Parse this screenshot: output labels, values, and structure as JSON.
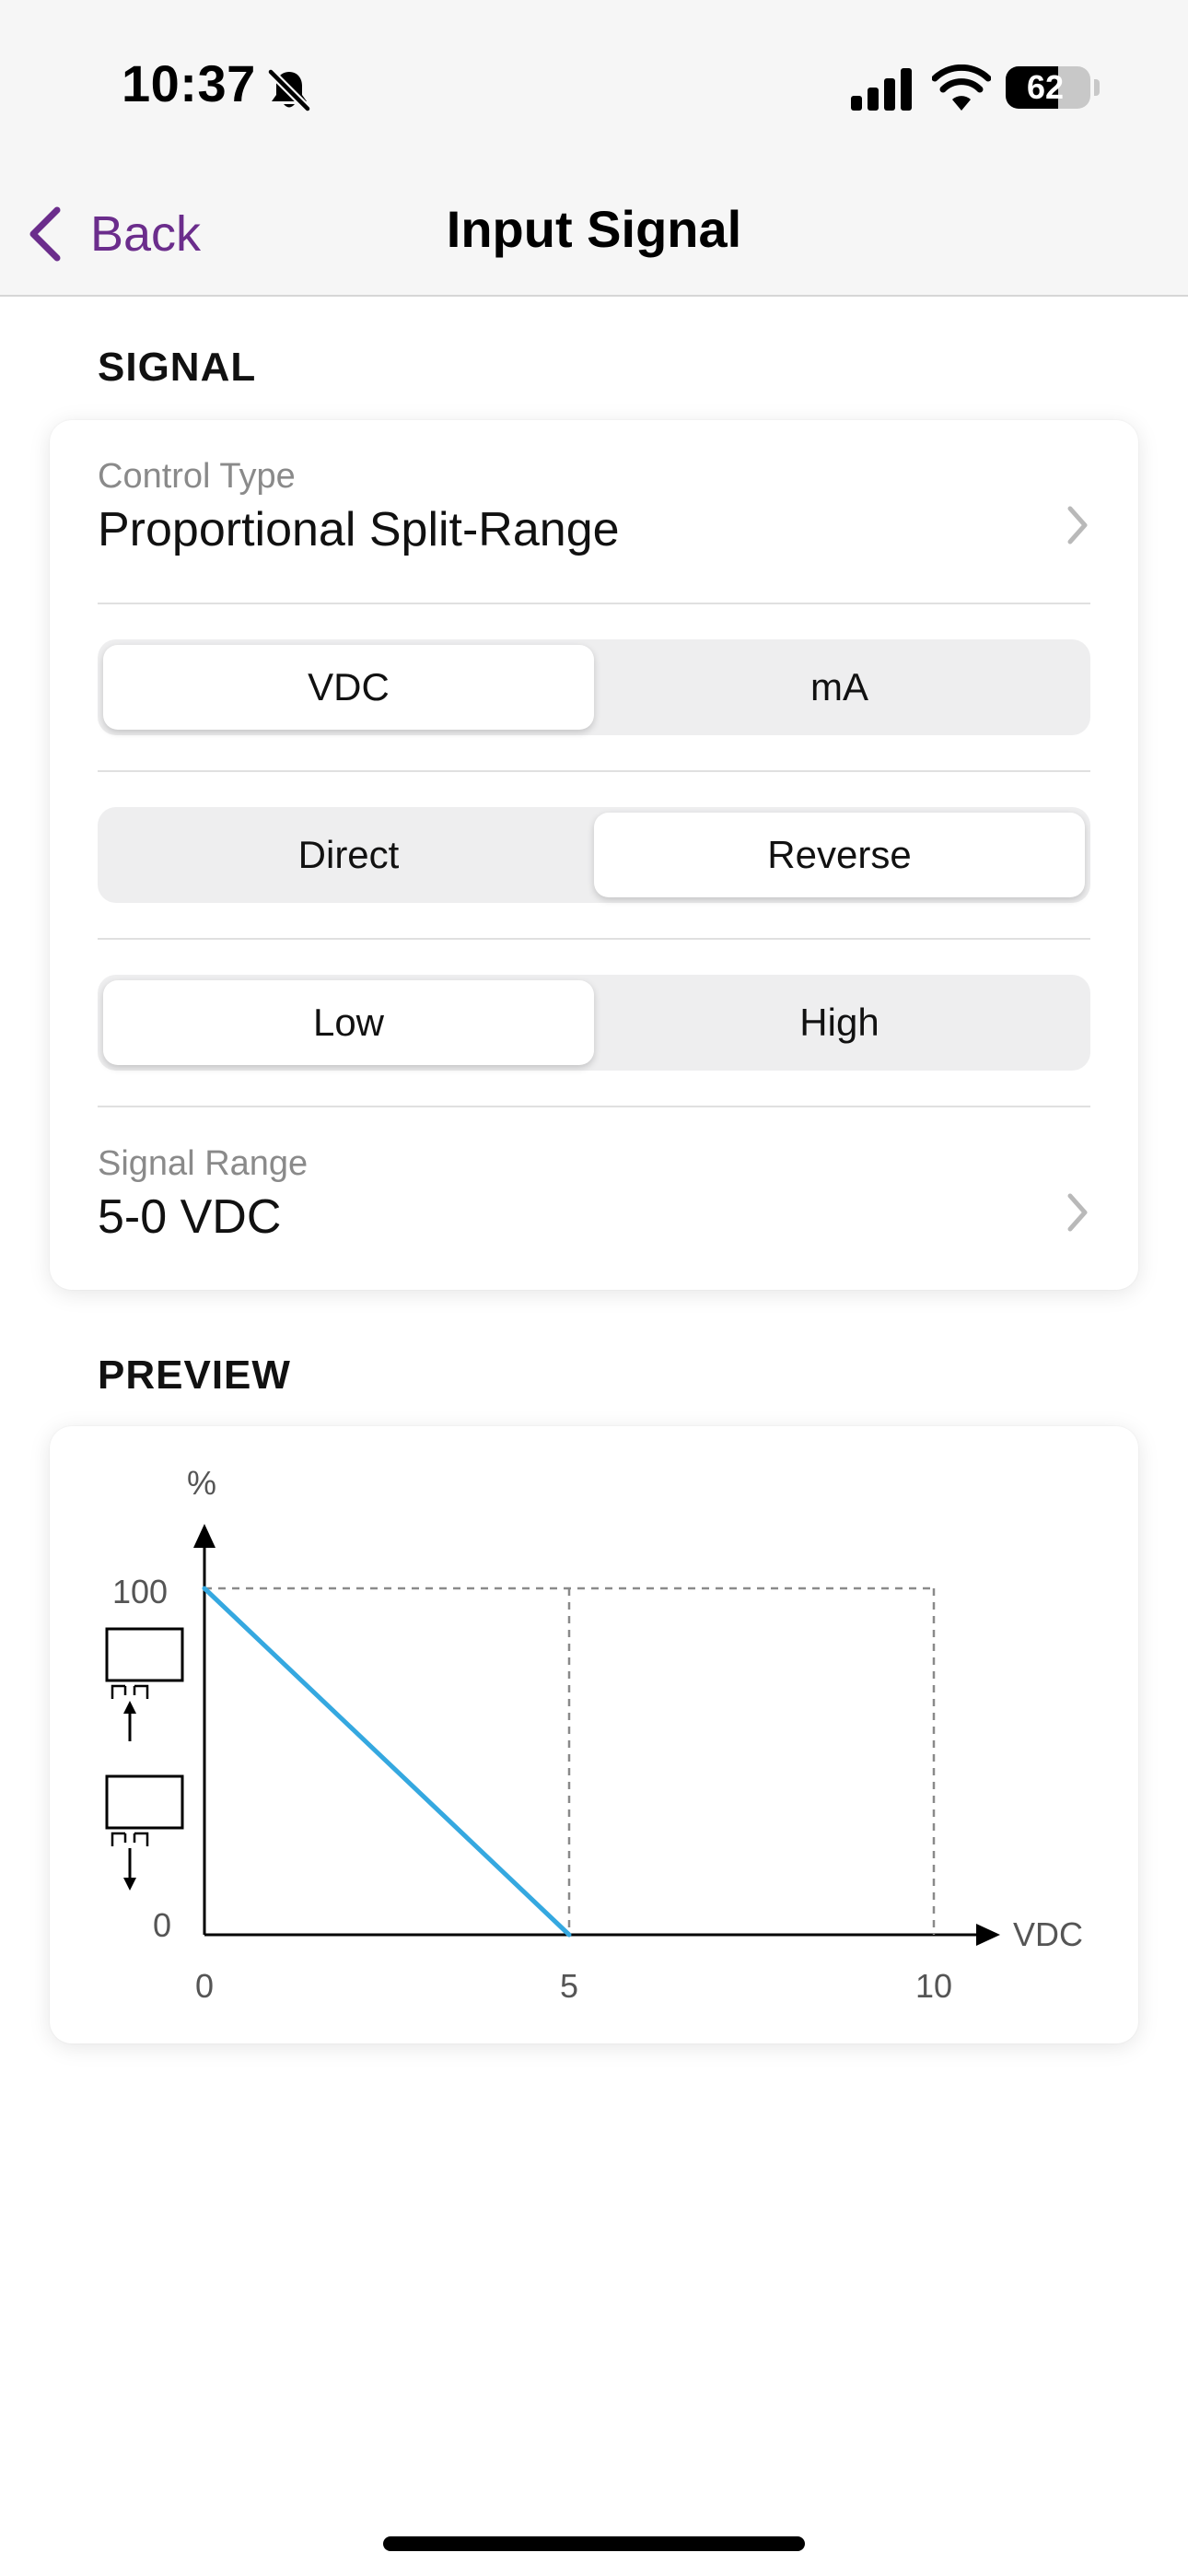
{
  "status_bar": {
    "time": "10:37",
    "battery_level": "62",
    "battery_fraction": 0.62
  },
  "nav": {
    "back_label": "Back",
    "title": "Input Signal",
    "accent_color": "#6b2d8c"
  },
  "signal_section": {
    "header": "SIGNAL",
    "control_type": {
      "caption": "Control Type",
      "value": "Proportional Split-Range"
    },
    "unit_segment": {
      "options": [
        "VDC",
        "mA"
      ],
      "selected": "VDC"
    },
    "action_segment": {
      "options": [
        "Direct",
        "Reverse"
      ],
      "selected": "Reverse"
    },
    "level_segment": {
      "options": [
        "Low",
        "High"
      ],
      "selected": "Low"
    },
    "signal_range": {
      "caption": "Signal Range",
      "value": "5-0 VDC"
    }
  },
  "preview_section": {
    "header": "PREVIEW"
  },
  "chart_data": {
    "type": "line",
    "xlabel": "VDC",
    "ylabel": "%",
    "xlim": [
      0,
      10
    ],
    "ylim": [
      0,
      100
    ],
    "x_ticks": [
      "0",
      "5",
      "10"
    ],
    "y_ticks": [
      "0",
      "100"
    ],
    "series": [
      {
        "x": [
          0,
          5
        ],
        "y": [
          100,
          0
        ],
        "color": "#35a8e0"
      }
    ],
    "reference_lines": {
      "y": 100,
      "x": [
        5,
        10
      ],
      "style": "dashed"
    }
  }
}
